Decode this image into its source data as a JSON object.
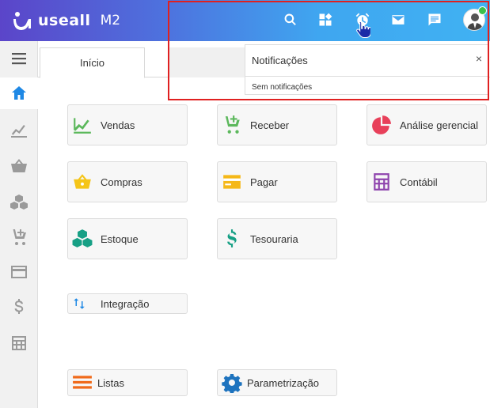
{
  "app": {
    "logo_text": "useall",
    "logo_version": "M2",
    "brand_gradient": [
      "#5b45c9",
      "#40b2f3"
    ]
  },
  "header": {
    "icons": [
      "search-icon",
      "apps-icon",
      "alarm-icon",
      "mail-icon",
      "chat-icon",
      "user-avatar"
    ]
  },
  "sidebar": {
    "items": [
      "menu-icon",
      "home-icon",
      "trend-icon",
      "basket-icon",
      "cubes-icon",
      "cart-add-icon",
      "card-icon",
      "dollar-icon",
      "calculator-icon"
    ],
    "active": "home-icon"
  },
  "tabs": [
    {
      "label": "Início",
      "active": true
    }
  ],
  "notifications": {
    "title": "Notificações",
    "close": "×",
    "empty": "Sem notificações"
  },
  "modules": {
    "vendas": "Vendas",
    "receber": "Receber",
    "analise": "Análise gerencial",
    "compras": "Compras",
    "pagar": "Pagar",
    "contabil": "Contábil",
    "estoque": "Estoque",
    "tesouraria": "Tesouraria",
    "integracao": "Integração",
    "listas": "Listas",
    "parametrizacao": "Parametrização"
  },
  "colors": {
    "vendas": "#5cb85c",
    "receber": "#5cb85c",
    "analise": "#e8405a",
    "compras": "#f5c518",
    "pagar": "#f5b818",
    "contabil": "#8e44ad",
    "estoque": "#17a085",
    "tesouraria": "#17a085",
    "integracao": "#1e88e5",
    "listas": "#f06a1a",
    "parametrizacao": "#1e73be",
    "highlight": "#e02020",
    "online": "#3cc04a"
  }
}
